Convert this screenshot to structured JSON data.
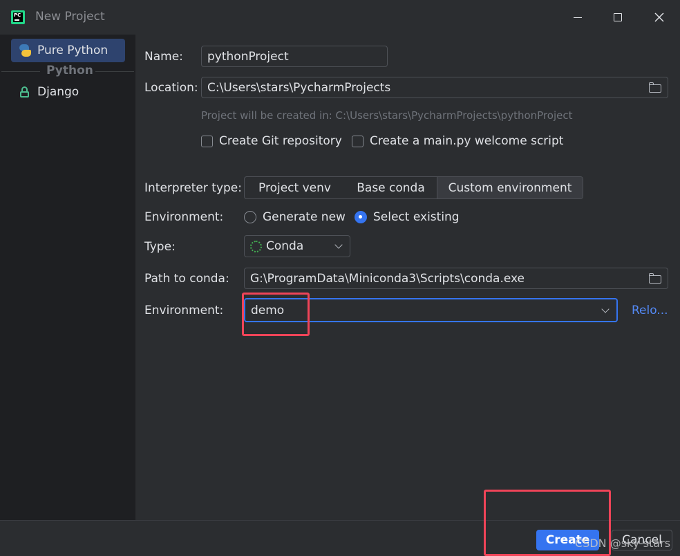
{
  "window": {
    "title": "New Project",
    "logo_text": "PC"
  },
  "sidebar": {
    "items": [
      {
        "label": "Pure Python",
        "icon": "python-icon",
        "selected": true
      },
      {
        "label": "Django",
        "icon": "lock-icon",
        "selected": false
      }
    ],
    "group_label": "Python"
  },
  "form": {
    "name_label": "Name:",
    "name_value": "pythonProject",
    "location_label": "Location:",
    "location_value": "C:\\Users\\stars\\PycharmProjects",
    "location_hint": "Project will be created in: C:\\Users\\stars\\PycharmProjects\\pythonProject",
    "git_checkbox_label": "Create Git repository",
    "main_checkbox_label": "Create a main.py welcome script",
    "interpreter_type_label": "Interpreter type:",
    "interpreter_tabs": [
      "Project venv",
      "Base conda",
      "Custom environment"
    ],
    "interpreter_selected": "Custom environment",
    "environment_label": "Environment:",
    "env_radio_generate": "Generate new",
    "env_radio_select": "Select existing",
    "env_radio_selected": "Select existing",
    "type_label": "Type:",
    "type_value": "Conda",
    "path_label": "Path to conda:",
    "path_value": "G:\\ProgramData\\Miniconda3\\Scripts\\conda.exe",
    "env2_label": "Environment:",
    "env2_value": "demo",
    "reload_link": "Relo..."
  },
  "footer": {
    "create_label": "Create",
    "cancel_label": "Cancel"
  },
  "watermark": "CSDN @sky-stars",
  "colors": {
    "accent": "#3574f0",
    "highlight": "#ef4458",
    "link": "#548af7"
  }
}
